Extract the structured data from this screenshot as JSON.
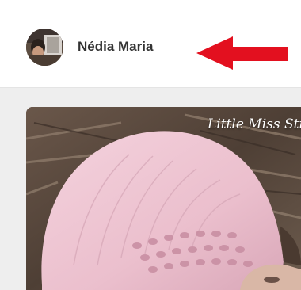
{
  "user": {
    "name": "Nédia Maria",
    "avatar_icon": "user-avatar"
  },
  "annotation": {
    "icon": "red-arrow-left-icon",
    "color": "#e3101f"
  },
  "pin": {
    "watermark": "Little Miss Stitch",
    "image_icon": "pink-knit-hat-photo"
  },
  "colors": {
    "hat": "#eec4d1",
    "background": "#eeeeee"
  }
}
